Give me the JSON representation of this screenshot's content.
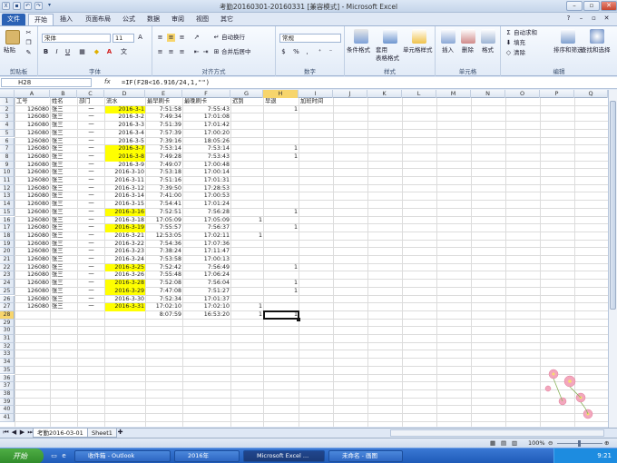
{
  "window": {
    "title": "考勤20160301-20160331  [兼容模式] - Microsoft Excel"
  },
  "ribbon_tabs": [
    "文件",
    "开始",
    "插入",
    "页面布局",
    "公式",
    "数据",
    "审阅",
    "视图",
    "其它"
  ],
  "ribbon": {
    "clipboard": {
      "paste": "粘贴",
      "group": "剪贴板"
    },
    "font": {
      "name": "宋体",
      "size": "11",
      "bold": "B",
      "italic": "I",
      "underline": "U",
      "group": "字体"
    },
    "alignment": {
      "wrap": "自动换行",
      "merge": "合并后居中",
      "group": "对齐方式"
    },
    "number": {
      "format": "常规",
      "percent": "%",
      "comma": ",",
      "group": "数字"
    },
    "styles": {
      "conditional": "条件格式",
      "table": "套用\n表格格式",
      "cell": "单元格样式",
      "group": "样式"
    },
    "cells": {
      "insert": "插入",
      "delete": "删除",
      "format": "格式",
      "group": "单元格"
    },
    "editing": {
      "autosum": "自动求和",
      "fill": "填充",
      "clear": "清除",
      "sort": "排序和筛选",
      "find": "查找和选择",
      "group": "编辑"
    }
  },
  "formula_bar": {
    "name_box": "H28",
    "fx": "fx",
    "formula": "=IF(F28<16.916/24,1,\"\")"
  },
  "columns": [
    "A",
    "B",
    "C",
    "D",
    "E",
    "F",
    "G",
    "H",
    "I",
    "J",
    "K",
    "L",
    "M",
    "N",
    "O",
    "P",
    "Q"
  ],
  "header_row": {
    "a": "工号",
    "b": "姓名",
    "c": "部门",
    "d": "流水",
    "e": "最早刷卡",
    "f": "最晚刷卡",
    "g": "迟到",
    "h": "早退",
    "i": "加班时间"
  },
  "rows": [
    {
      "a": "126080",
      "b": "张三",
      "c": "一",
      "d": "2016-3-1",
      "e": "7:51:58",
      "f": "7:55:43",
      "g": "",
      "h": "1",
      "hl": true
    },
    {
      "a": "126080",
      "b": "张三",
      "c": "一",
      "d": "2016-3-2",
      "e": "7:49:34",
      "f": "17:01:08",
      "g": "",
      "h": "",
      "hl": false
    },
    {
      "a": "126080",
      "b": "张三",
      "c": "一",
      "d": "2016-3-3",
      "e": "7:51:39",
      "f": "17:01:42",
      "g": "",
      "h": "",
      "hl": false
    },
    {
      "a": "126080",
      "b": "张三",
      "c": "一",
      "d": "2016-3-4",
      "e": "7:57:39",
      "f": "17:00:20",
      "g": "",
      "h": "",
      "hl": false
    },
    {
      "a": "126080",
      "b": "张三",
      "c": "一",
      "d": "2016-3-5",
      "e": "7:39:16",
      "f": "18:05:26",
      "g": "",
      "h": "",
      "hl": false
    },
    {
      "a": "126080",
      "b": "张三",
      "c": "一",
      "d": "2016-3-7",
      "e": "7:53:14",
      "f": "7:53:14",
      "g": "",
      "h": "1",
      "hl": true
    },
    {
      "a": "126080",
      "b": "张三",
      "c": "一",
      "d": "2016-3-8",
      "e": "7:49:28",
      "f": "7:53:43",
      "g": "",
      "h": "1",
      "hl": true
    },
    {
      "a": "126080",
      "b": "张三",
      "c": "一",
      "d": "2016-3-9",
      "e": "7:49:07",
      "f": "17:00:48",
      "g": "",
      "h": "",
      "hl": false
    },
    {
      "a": "126080",
      "b": "张三",
      "c": "一",
      "d": "2016-3-10",
      "e": "7:53:18",
      "f": "17:00:14",
      "g": "",
      "h": "",
      "hl": false
    },
    {
      "a": "126080",
      "b": "张三",
      "c": "一",
      "d": "2016-3-11",
      "e": "7:51:16",
      "f": "17:01:31",
      "g": "",
      "h": "",
      "hl": false
    },
    {
      "a": "126080",
      "b": "张三",
      "c": "一",
      "d": "2016-3-12",
      "e": "7:39:50",
      "f": "17:28:53",
      "g": "",
      "h": "",
      "hl": false
    },
    {
      "a": "126080",
      "b": "张三",
      "c": "一",
      "d": "2016-3-14",
      "e": "7:41:00",
      "f": "17:00:53",
      "g": "",
      "h": "",
      "hl": false
    },
    {
      "a": "126080",
      "b": "张三",
      "c": "一",
      "d": "2016-3-15",
      "e": "7:54:41",
      "f": "17:01:24",
      "g": "",
      "h": "",
      "hl": false
    },
    {
      "a": "126080",
      "b": "张三",
      "c": "一",
      "d": "2016-3-16",
      "e": "7:52:51",
      "f": "7:56:28",
      "g": "",
      "h": "1",
      "hl": true
    },
    {
      "a": "126080",
      "b": "张三",
      "c": "一",
      "d": "2016-3-18",
      "e": "17:05:09",
      "f": "17:05:09",
      "g": "1",
      "h": "",
      "hl": false
    },
    {
      "a": "126080",
      "b": "张三",
      "c": "一",
      "d": "2016-3-19",
      "e": "7:55:57",
      "f": "7:56:37",
      "g": "",
      "h": "1",
      "hl": true
    },
    {
      "a": "126080",
      "b": "张三",
      "c": "一",
      "d": "2016-3-21",
      "e": "12:53:05",
      "f": "17:02:11",
      "g": "1",
      "h": "",
      "hl": false
    },
    {
      "a": "126080",
      "b": "张三",
      "c": "一",
      "d": "2016-3-22",
      "e": "7:54:36",
      "f": "17:07:36",
      "g": "",
      "h": "",
      "hl": false
    },
    {
      "a": "126080",
      "b": "张三",
      "c": "一",
      "d": "2016-3-23",
      "e": "7:38:24",
      "f": "17:11:47",
      "g": "",
      "h": "",
      "hl": false
    },
    {
      "a": "126080",
      "b": "张三",
      "c": "一",
      "d": "2016-3-24",
      "e": "7:53:58",
      "f": "17:00:13",
      "g": "",
      "h": "",
      "hl": false
    },
    {
      "a": "126080",
      "b": "张三",
      "c": "一",
      "d": "2016-3-25",
      "e": "7:52:42",
      "f": "7:56:49",
      "g": "",
      "h": "1",
      "hl": true
    },
    {
      "a": "126080",
      "b": "张三",
      "c": "一",
      "d": "2016-3-26",
      "e": "7:55:48",
      "f": "17:06:24",
      "g": "",
      "h": "",
      "hl": false
    },
    {
      "a": "126080",
      "b": "张三",
      "c": "一",
      "d": "2016-3-28",
      "e": "7:52:08",
      "f": "7:56:04",
      "g": "",
      "h": "1",
      "hl": true
    },
    {
      "a": "126080",
      "b": "张三",
      "c": "一",
      "d": "2016-3-29",
      "e": "7:47:08",
      "f": "7:51:27",
      "g": "",
      "h": "1",
      "hl": true
    },
    {
      "a": "126080",
      "b": "张三",
      "c": "一",
      "d": "2016-3-30",
      "e": "7:52:34",
      "f": "17:01:37",
      "g": "",
      "h": "",
      "hl": false
    },
    {
      "a": "126080",
      "b": "张三",
      "c": "一",
      "d": "2016-3-31",
      "e": "17:02:10",
      "f": "17:02:10",
      "g": "1",
      "h": "",
      "hl": true
    },
    {
      "a": "",
      "b": "",
      "c": "",
      "d": "",
      "e": "8:07:59",
      "f": "16:53:20",
      "g": "1",
      "h": "1",
      "hl": false
    }
  ],
  "selected_cell": "H28",
  "sheet_tabs": [
    "考勤2016-03-01",
    "Sheet1"
  ],
  "status": {
    "zoom": "100%"
  },
  "taskbar": {
    "start": "开始",
    "items": [
      "收件箱 - Outlook",
      "2016年",
      "Microsoft Excel ...",
      "未命名 - 画图"
    ],
    "clock": "9:21"
  },
  "colors": {
    "highlight": "#ffff00",
    "accent": "#2b62b5",
    "selection": "#f7d56c"
  }
}
